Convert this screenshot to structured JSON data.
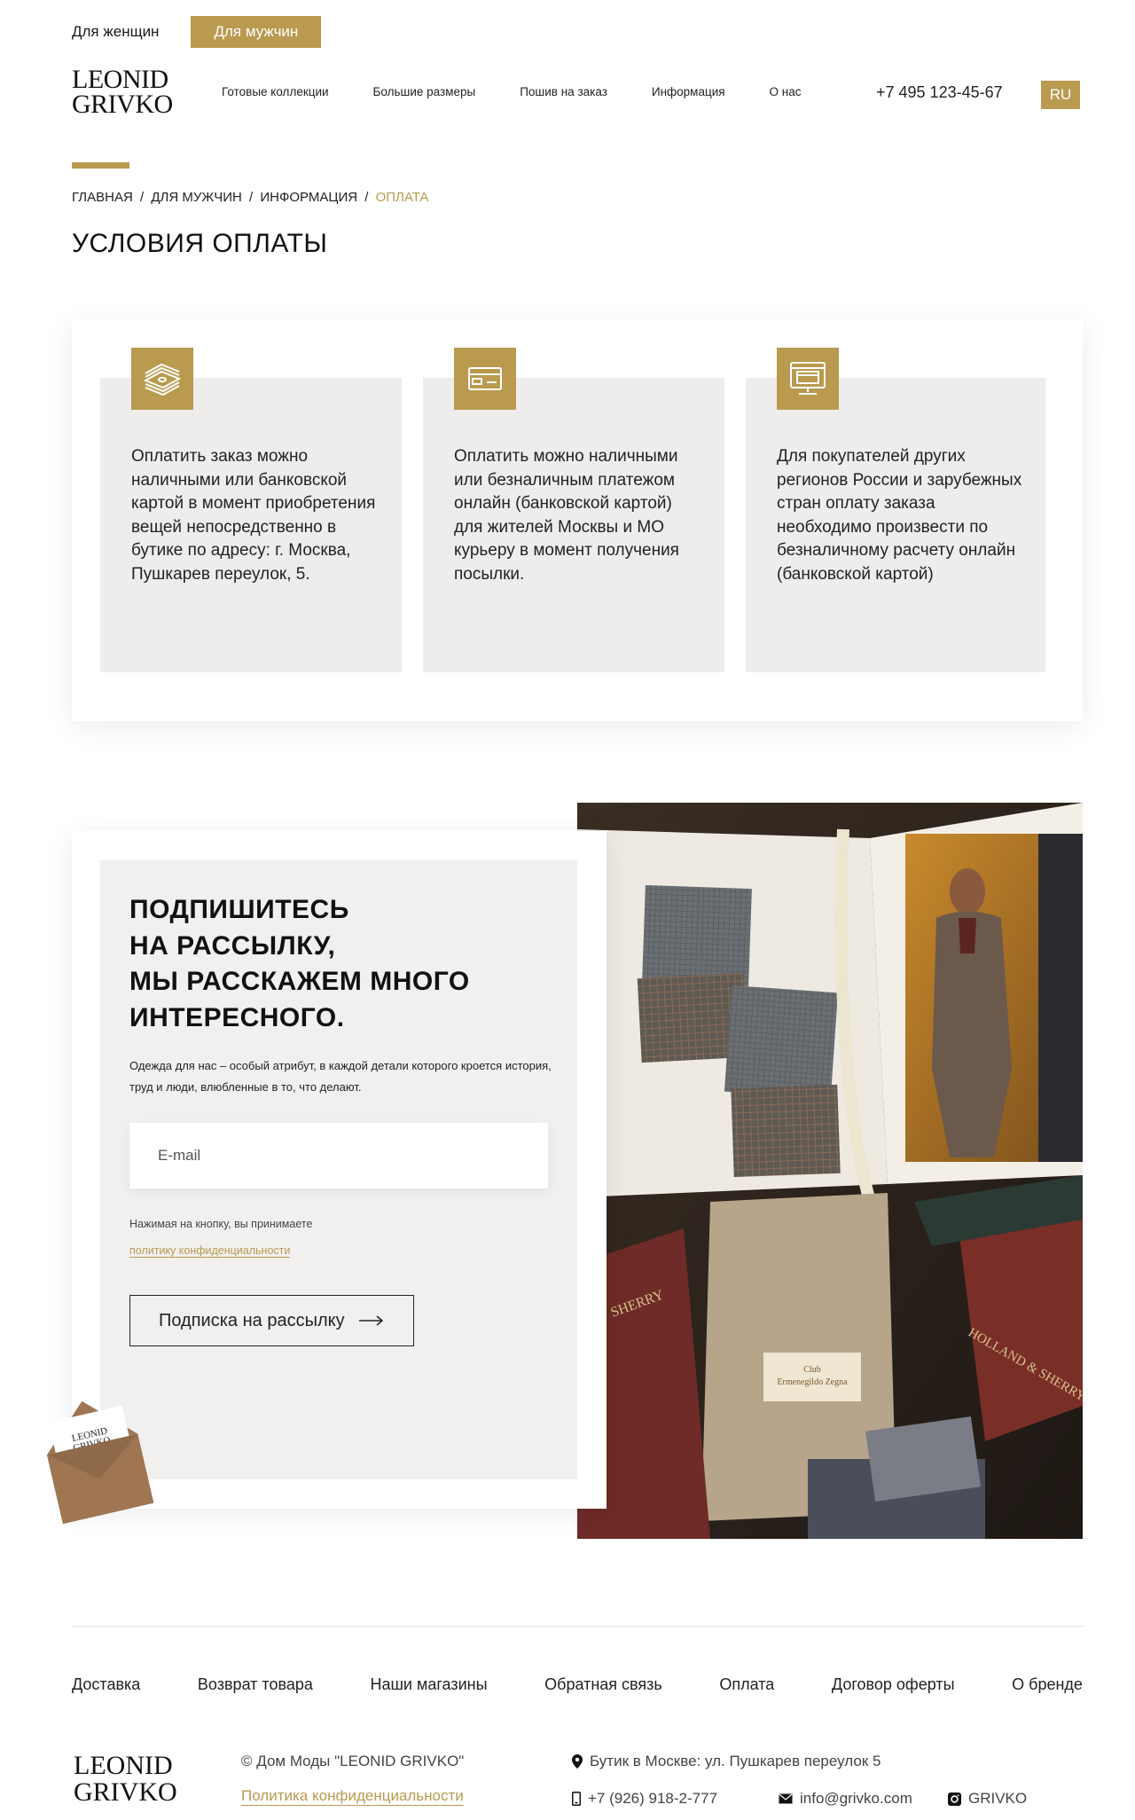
{
  "gender": {
    "women": "Для женщин",
    "men": "Для мужчин"
  },
  "logo": {
    "line1": "LEONID",
    "line2": "GRIVKO"
  },
  "nav": [
    "Готовые коллекции",
    "Большие размеры",
    "Пошив на заказ",
    "Информация",
    "О нас"
  ],
  "phone": "+7 495 123-45-67",
  "lang": "RU",
  "breadcrumb": {
    "home": "ГЛАВНАЯ",
    "men": "ДЛЯ МУЖЧИН",
    "info": "ИНФОРМАЦИЯ",
    "current": "ОПЛАТА",
    "sep": "/"
  },
  "page_title": "УСЛОВИЯ ОПЛАТЫ",
  "payment": [
    {
      "icon": "cash-stack-icon",
      "text": "Оплатить заказ можно наличными или банковской картой в момент приобретения вещей непосредственно в бутике по адресу: г. Москва, Пушкарев переулок, 5."
    },
    {
      "icon": "credit-card-icon",
      "text": "Оплатить можно наличными или безналичным платежом онлайн (банковской картой) для жителей Москвы и МО курьеру в момент получения посылки."
    },
    {
      "icon": "online-payment-icon",
      "text": "Для покупателей других регионов России и зарубежных стран оплату заказа необходимо произвести по безналичному расчету онлайн (банковской картой)"
    }
  ],
  "subscribe": {
    "title_l1": "ПОДПИШИТЕСЬ",
    "title_l2": "НА РАССЫЛКУ,",
    "title_l3": "МЫ РАССКАЖЕМ МНОГО",
    "title_l4": "ИНТЕРЕСНОГО.",
    "desc": "Одежда для нас – особый атрибут, в каждой детали которого кроется история, труд и люди, влюбленные в то, что делают.",
    "email_placeholder": "E-mail",
    "consent": "Нажимая на кнопку, вы принимаете",
    "consent_link": "политику конфиденциальности",
    "button": "Подписка на рассылку"
  },
  "envelope_logo": {
    "line1": "LEONID",
    "line2": "GRIVKO"
  },
  "photo_labels": {
    "label_l1": "Club",
    "label_l2": "Ermenegildo Zegna",
    "book1": "SHERRY",
    "book2": "HOLLAND & SHERRY"
  },
  "footer": {
    "nav": [
      "Доставка",
      "Возврат товара",
      "Наши магазины",
      "Обратная связь",
      "Оплата",
      "Договор оферты",
      "О бренде"
    ],
    "copyright": "© Дом Моды \"LEONID GRIVKO\"",
    "privacy": "Политика конфиденциальности",
    "address": "Бутик в Москве: ул. Пушкарев переулок 5",
    "phone": "+7 (926) 918-2-777",
    "email": "info@grivko.com",
    "instagram": "GRIVKO"
  },
  "colors": {
    "accent": "#b99a4f",
    "card_bg": "#eeedeb"
  }
}
